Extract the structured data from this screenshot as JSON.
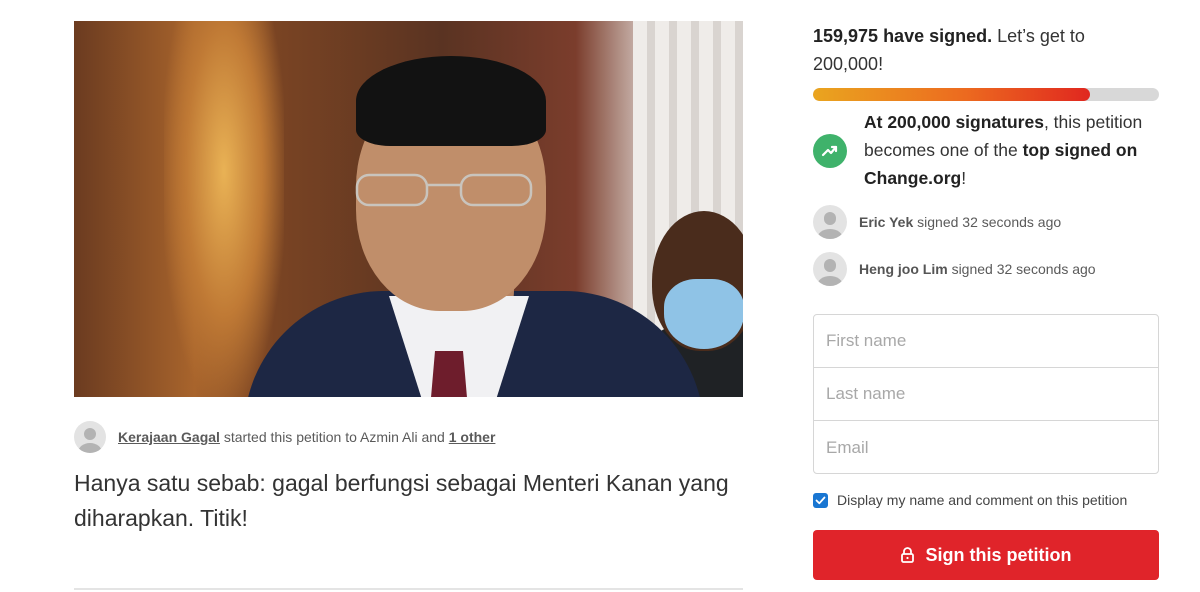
{
  "starter": {
    "name": "Kerajaan Gagal",
    "middle": "started this petition to Azmin Ali and",
    "others": "1 other"
  },
  "petition": {
    "headline": "Hanya satu sebab: gagal berfungsi sebagai Menteri Kanan yang diharapkan. Titik!"
  },
  "signatures": {
    "count": "159,975 have signed.",
    "cta": "Let’s get to 200,000!",
    "progress_fraction": 0.8
  },
  "milestone": {
    "icon": "trending-up-icon",
    "part1": "At 200,000 signatures",
    "part2": ", this petition becomes one of the ",
    "part3": "top signed on Change.org",
    "part4": "!",
    "color": "#3fb26b"
  },
  "recent_signers": [
    {
      "name": "Eric Yek",
      "action": "signed 32 seconds ago"
    },
    {
      "name": "Heng joo Lim",
      "action": "signed 32 seconds ago"
    }
  ],
  "form": {
    "first_name_placeholder": "First name",
    "last_name_placeholder": "Last name",
    "email_placeholder": "Email"
  },
  "consent": {
    "label": "Display my name and comment on this petition",
    "checked": true
  },
  "sign_button": {
    "label": "Sign this petition",
    "icon": "lock-icon",
    "color": "#e0242a"
  }
}
